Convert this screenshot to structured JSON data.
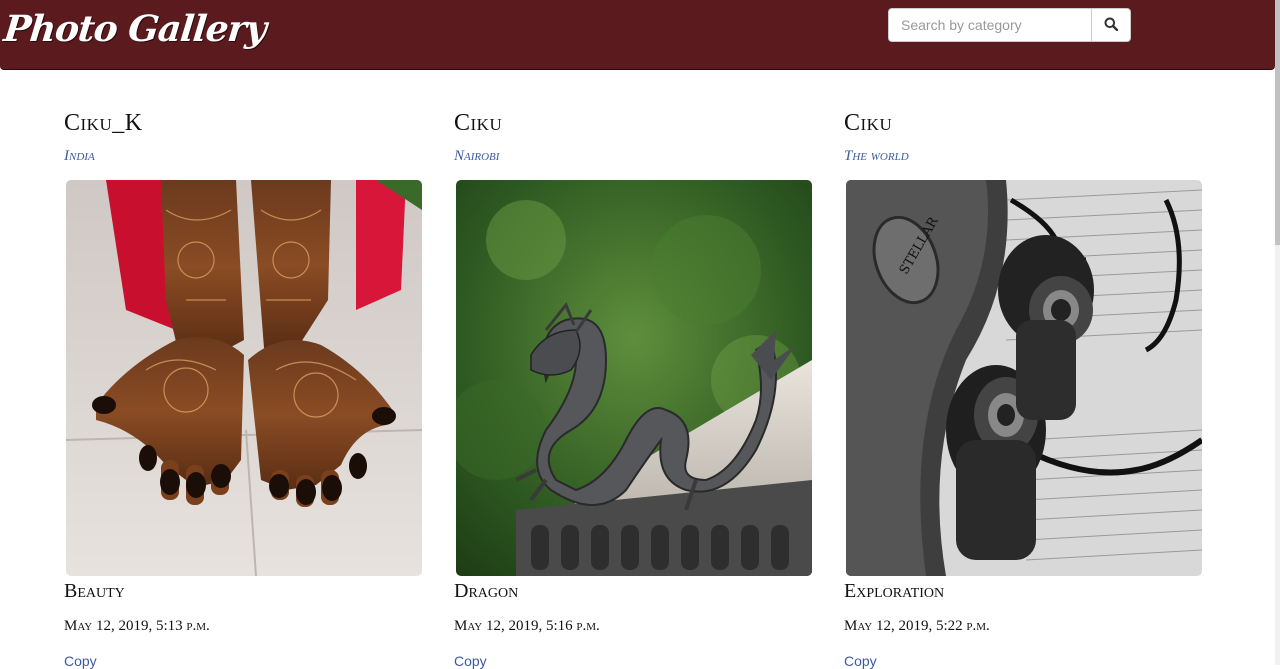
{
  "navbar": {
    "brand": "Photo Gallery",
    "search": {
      "placeholder": "Search by category",
      "value": "",
      "button_icon": "search-icon"
    },
    "background_color": "#5b1a1e"
  },
  "photos": [
    {
      "user": "Ciku_K",
      "location": "India",
      "category": "Beauty",
      "date": "May 12, 2019, 5:13 p.m.",
      "action": "Copy"
    },
    {
      "user": "Ciku",
      "location": "Nairobi",
      "category": "Dragon",
      "date": "May 12, 2019, 5:16 p.m.",
      "action": "Copy"
    },
    {
      "user": "Ciku",
      "location": "The world",
      "category": "Exploration",
      "date": "May 12, 2019, 5:22 p.m.",
      "action": "Copy"
    }
  ],
  "colors": {
    "accent_link": "#3a5aa0",
    "text": "#111111"
  }
}
